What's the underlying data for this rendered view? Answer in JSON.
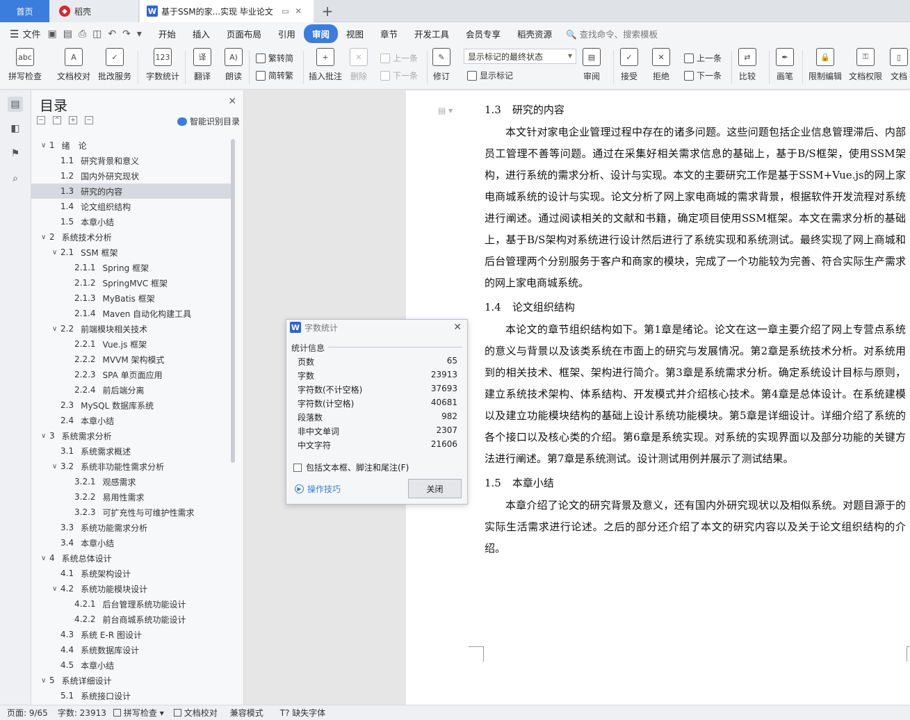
{
  "tabs": {
    "home": "首页",
    "daoke": "稻壳",
    "doc_title": "基于SSM的家...实现 毕业论文"
  },
  "menu": {
    "file": "文件",
    "items": [
      "开始",
      "插入",
      "页面布局",
      "引用",
      "审阅",
      "视图",
      "章节",
      "开发工具",
      "会员专享",
      "稻壳资源"
    ],
    "active_index": 4,
    "search": "查找命令、搜索模板"
  },
  "ribbon": {
    "spell": "拼写检查",
    "proof": "文档校对",
    "annot_service": "批改服务",
    "word_count": "字数统计",
    "translate": "翻译",
    "read_aloud": "朗读",
    "trad": "繁转简",
    "simp": "简转繁",
    "insert_comment": "插入批注",
    "delete": "删除",
    "prev_comment": "上一条",
    "next_comment": "下一条",
    "revise": "修订",
    "markup_state": "显示标记的最终状态",
    "show_markup": "显示标记",
    "review": "审阅",
    "accept": "接受",
    "reject": "拒绝",
    "prev": "上一条",
    "next": "下一条",
    "compare": "比较",
    "pen": "画笔",
    "restrict_edit": "限制编辑",
    "doc_perm": "文档权限",
    "doc_cut": "文档"
  },
  "toc": {
    "title": "目录",
    "smart": "智能识别目录",
    "items": [
      {
        "level": 1,
        "arrow": "∨",
        "num": "1",
        "text": "绪　论"
      },
      {
        "level": 2,
        "arrow": "",
        "num": "1.1",
        "text": "研究背景和意义"
      },
      {
        "level": 2,
        "arrow": "",
        "num": "1.2",
        "text": "国内外研究现状"
      },
      {
        "level": 2,
        "arrow": "",
        "num": "1.3",
        "text": "研究的内容",
        "selected": true
      },
      {
        "level": 2,
        "arrow": "",
        "num": "1.4",
        "text": "论文组织结构"
      },
      {
        "level": 2,
        "arrow": "",
        "num": "1.5",
        "text": "本章小结"
      },
      {
        "level": 1,
        "arrow": "∨",
        "num": "2",
        "text": "系统技术分析"
      },
      {
        "level": 2,
        "arrow": "∨",
        "num": "2.1",
        "text": "SSM 框架"
      },
      {
        "level": 3,
        "arrow": "",
        "num": "2.1.1",
        "text": "Spring 框架"
      },
      {
        "level": 3,
        "arrow": "",
        "num": "2.1.2",
        "text": "SpringMVC 框架"
      },
      {
        "level": 3,
        "arrow": "",
        "num": "2.1.3",
        "text": "MyBatis 框架"
      },
      {
        "level": 3,
        "arrow": "",
        "num": "2.1.4",
        "text": "Maven 自动化构建工具"
      },
      {
        "level": 2,
        "arrow": "∨",
        "num": "2.2",
        "text": "前端模块相关技术"
      },
      {
        "level": 3,
        "arrow": "",
        "num": "2.2.1",
        "text": "Vue.js 框架"
      },
      {
        "level": 3,
        "arrow": "",
        "num": "2.2.2",
        "text": "MVVM 架构模式"
      },
      {
        "level": 3,
        "arrow": "",
        "num": "2.2.3",
        "text": "SPA 单页面应用"
      },
      {
        "level": 3,
        "arrow": "",
        "num": "2.2.4",
        "text": "前后端分离"
      },
      {
        "level": 2,
        "arrow": "",
        "num": "2.3",
        "text": "MySQL 数据库系统"
      },
      {
        "level": 2,
        "arrow": "",
        "num": "2.4",
        "text": "本章小结"
      },
      {
        "level": 1,
        "arrow": "∨",
        "num": "3",
        "text": "系统需求分析"
      },
      {
        "level": 2,
        "arrow": "",
        "num": "3.1",
        "text": "系统需求概述"
      },
      {
        "level": 2,
        "arrow": "∨",
        "num": "3.2",
        "text": "系统非功能性需求分析"
      },
      {
        "level": 3,
        "arrow": "",
        "num": "3.2.1",
        "text": "观感需求"
      },
      {
        "level": 3,
        "arrow": "",
        "num": "3.2.2",
        "text": "易用性需求"
      },
      {
        "level": 3,
        "arrow": "",
        "num": "3.2.3",
        "text": "可扩充性与可维护性需求"
      },
      {
        "level": 2,
        "arrow": "",
        "num": "3.3",
        "text": "系统功能需求分析"
      },
      {
        "level": 2,
        "arrow": "",
        "num": "3.4",
        "text": "本章小结"
      },
      {
        "level": 1,
        "arrow": "∨",
        "num": "4",
        "text": "系统总体设计"
      },
      {
        "level": 2,
        "arrow": "",
        "num": "4.1",
        "text": "系统架构设计"
      },
      {
        "level": 2,
        "arrow": "∨",
        "num": "4.2",
        "text": "系统功能模块设计"
      },
      {
        "level": 3,
        "arrow": "",
        "num": "4.2.1",
        "text": "后台管理系统功能设计"
      },
      {
        "level": 3,
        "arrow": "",
        "num": "4.2.2",
        "text": "前台商城系统功能设计"
      },
      {
        "level": 2,
        "arrow": "",
        "num": "4.3",
        "text": "系统 E-R 图设计"
      },
      {
        "level": 2,
        "arrow": "",
        "num": "4.4",
        "text": "系统数据库设计"
      },
      {
        "level": 2,
        "arrow": "",
        "num": "4.5",
        "text": "本章小结"
      },
      {
        "level": 1,
        "arrow": "∨",
        "num": "5",
        "text": "系统详细设计"
      },
      {
        "level": 2,
        "arrow": "",
        "num": "5.1",
        "text": "系统接口设计"
      }
    ]
  },
  "document": {
    "sections": [
      {
        "num": "1.3",
        "title": "研究的内容",
        "para": "本文针对家电企业管理过程中存在的诸多问题。这些问题包括企业信息管理滞后、内部员工管理不善等问题。通过在采集好相关需求信息的基础上，基于B/S框架，使用SSM架构，进行系统的需求分析、设计与实现。本文的主要研究工作是基于SSM+Vue.js的网上家电商城系统的设计与实现。论文分析了网上家电商城的需求背景，根据软件开发流程对系统进行阐述。通过阅读相关的文献和书籍，确定项目使用SSM框架。本文在需求分析的基础上，基于B/S架构对系统进行设计然后进行了系统实现和系统测试。最终实现了网上商城和后台管理两个分别服务于客户和商家的模块，完成了一个功能较为完善、符合实际生产需求的网上家电商城系统。"
      },
      {
        "num": "1.4",
        "title": "论文组织结构",
        "para": "本论文的章节组织结构如下。第1章是绪论。论文在这一章主要介绍了网上专营点系统的意义与背景以及该类系统在市面上的研究与发展情况。第2章是系统技术分析。对系统用到的相关技术、框架、架构进行简介。第3章是系统需求分析。确定系统设计目标与原则，建立系统技术架构、体系结构、开发模式并介绍核心技术。第4章是总体设计。在系统建模以及建立功能模块结构的基础上设计系统功能模块。第5章是详细设计。详细介绍了系统的各个接口以及核心类的介绍。第6章是系统实现。对系统的实现界面以及部分功能的关键方法进行阐述。第7章是系统测试。设计测试用例并展示了测试结果。"
      },
      {
        "num": "1.5",
        "title": "本章小结",
        "para": "本章介绍了论文的研究背景及意义，还有国内外研究现状以及相似系统。对题目源于的实际生活需求进行论述。之后的部分还介绍了本文的研究内容以及关于论文组织结构的介绍。"
      }
    ]
  },
  "dialog": {
    "title": "字数统计",
    "section": "统计信息",
    "rows": [
      {
        "label": "页数",
        "value": "65"
      },
      {
        "label": "字数",
        "value": "23913"
      },
      {
        "label": "字符数(不计空格)",
        "value": "37693"
      },
      {
        "label": "字符数(计空格)",
        "value": "40681"
      },
      {
        "label": "段落数",
        "value": "982"
      },
      {
        "label": "非中文单词",
        "value": "2307"
      },
      {
        "label": "中文字符",
        "value": "21606"
      }
    ],
    "checkbox": "包括文本框、脚注和尾注(F)",
    "tips": "操作技巧",
    "close": "关闭"
  },
  "status": {
    "page": "页面: 9/65",
    "words": "字数: 23913",
    "spell": "拼写检查",
    "proof": "文档校对",
    "compat": "兼容模式",
    "missing_font": "缺失字体"
  },
  "colors": {
    "accent": "#3b7ddd",
    "selected_toc": "#d6dae0"
  }
}
